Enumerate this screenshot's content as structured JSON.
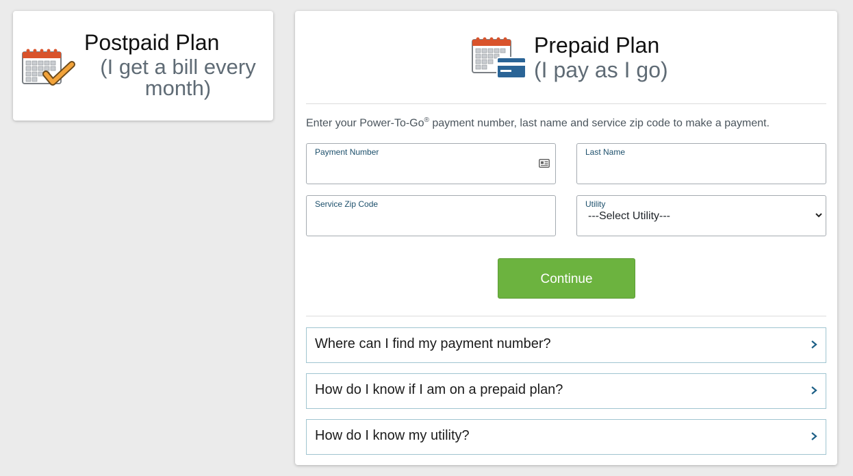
{
  "postpaid": {
    "title": "Postpaid Plan",
    "subtitle_line1": "(I get a bill every",
    "subtitle_line2": "month)",
    "icon": "calendar-check-icon"
  },
  "prepaid": {
    "title": "Prepaid Plan",
    "subtitle": "(I pay as I go)",
    "icon": "calendar-card-icon",
    "instructions_before": "Enter your Power-To-Go",
    "instructions_sup": "®",
    "instructions_after": " payment number, last name and service zip code to make a payment.",
    "fields": {
      "payment_number": {
        "label": "Payment Number",
        "value": "",
        "icon": "card-id-icon"
      },
      "last_name": {
        "label": "Last Name",
        "value": ""
      },
      "zip": {
        "label": "Service Zip Code",
        "value": ""
      },
      "utility": {
        "label": "Utility",
        "selected": "---Select Utility---"
      }
    },
    "continue_label": "Continue",
    "faqs": [
      {
        "question": "Where can I find my payment number?"
      },
      {
        "question": "How do I know if I am on a prepaid plan?"
      },
      {
        "question": "How do I know my utility?"
      }
    ]
  },
  "colors": {
    "background": "#ebebeb",
    "accent_green": "#6cb33f",
    "label_blue": "#1c4f6b",
    "faq_border": "#9fc4d0",
    "calendar_red": "#d9532b",
    "check_orange": "#f2a33a",
    "card_blue": "#2a6496"
  }
}
